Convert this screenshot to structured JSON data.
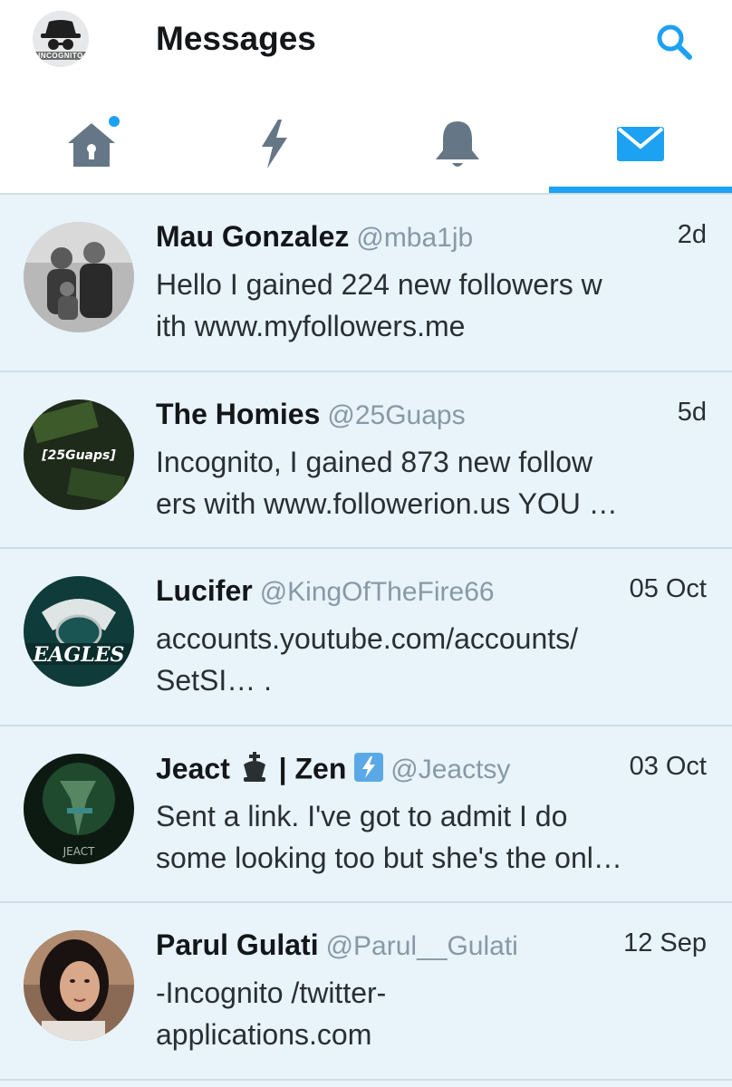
{
  "header": {
    "title": "Messages",
    "account_tag": "INCOGNITO"
  },
  "tabs": [
    {
      "name": "home",
      "icon": "home-icon",
      "has_dot": true,
      "active": false
    },
    {
      "name": "moments",
      "icon": "lightning-icon",
      "active": false
    },
    {
      "name": "notifications",
      "icon": "bell-icon",
      "active": false
    },
    {
      "name": "messages",
      "icon": "envelope-icon",
      "active": true
    }
  ],
  "colors": {
    "accent": "#1da1f2",
    "inactive_icon": "#657786",
    "row_bg": "#e8f3fa"
  },
  "messages": [
    {
      "name": "Mau Gonzalez",
      "handle": "@mba1jb",
      "time": "2d",
      "preview_line1": "Hello  I gained 224 new followers w",
      "preview_line2": "ith www.myfollowers.me"
    },
    {
      "name": "The Homies",
      "handle": "@25Guaps",
      "time": "5d",
      "avatar_text": "[25Guaps]",
      "preview_line1": "Incognito,  I gained 873 new follow",
      "preview_line2": "ers with www.followerion.us YOU …"
    },
    {
      "name": "Lucifer",
      "handle": "@KingOfTheFire66",
      "time": "05 Oct",
      "avatar_text": "EAGLES",
      "preview_line1": "accounts.youtube.com/accounts/",
      "preview_line2": "SetSI… ."
    },
    {
      "name_part1": "Jeact",
      "name_part2": "| Zen",
      "handle": "@Jeactsy",
      "time": "03 Oct",
      "avatar_text": "JEACT",
      "preview_line1": "Sent a link. I've got to admit I do",
      "preview_line2": "some looking too but she's the onl…"
    },
    {
      "name": "Parul Gulati",
      "handle": "@Parul__Gulati",
      "time": "12 Sep",
      "preview_line1": "-Incognito /twitter-",
      "preview_line2": "applications.com"
    }
  ]
}
